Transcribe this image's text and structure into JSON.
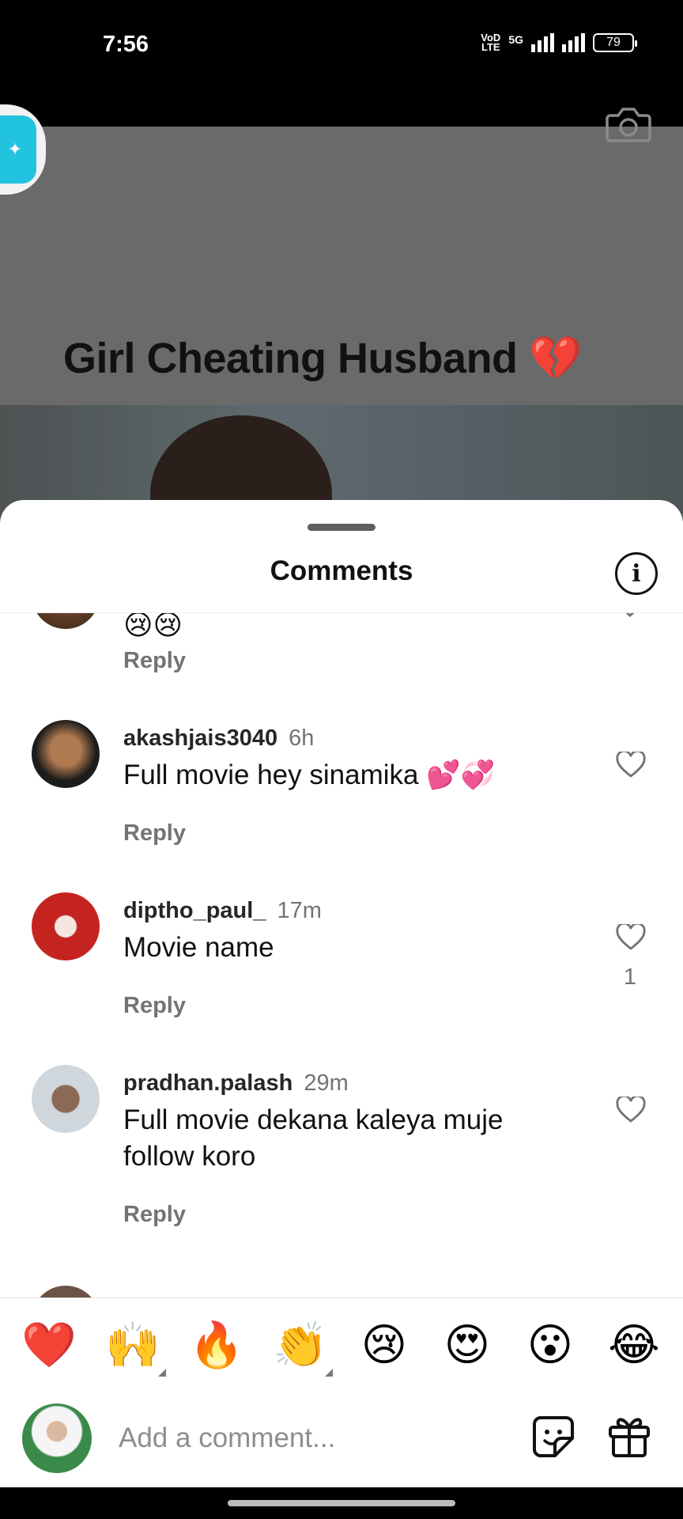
{
  "status_bar": {
    "time": "7:56",
    "network_label_top": "VoD",
    "network_label_bottom": "LTE",
    "network_type": "5G",
    "battery": "79"
  },
  "video": {
    "title": "Girl Cheating Husband 💔"
  },
  "sheet": {
    "title": "Comments"
  },
  "comments": [
    {
      "username": "",
      "time": "",
      "text": "😢😢",
      "reply_label": "Reply",
      "likes": ""
    },
    {
      "username": "akashjais3040",
      "time": "6h",
      "text": "Full movie hey sinamika 💕💞",
      "reply_label": "Reply",
      "likes": ""
    },
    {
      "username": "diptho_paul_",
      "time": "17m",
      "text": "Movie name",
      "reply_label": "Reply",
      "likes": "1"
    },
    {
      "username": "pradhan.palash",
      "time": "29m",
      "text": "Full movie dekana kaleya muje follow koro",
      "reply_label": "Reply",
      "likes": ""
    }
  ],
  "emoji_bar": [
    "❤️",
    "🙌",
    "🔥",
    "👏",
    "😢",
    "😍",
    "😮",
    "😂"
  ],
  "composer": {
    "placeholder": "Add a comment..."
  },
  "icons": {
    "info": "info-icon",
    "heart": "heart-outline-icon",
    "sticker": "sticker-icon",
    "gift": "gift-icon",
    "camera": "camera-icon"
  }
}
